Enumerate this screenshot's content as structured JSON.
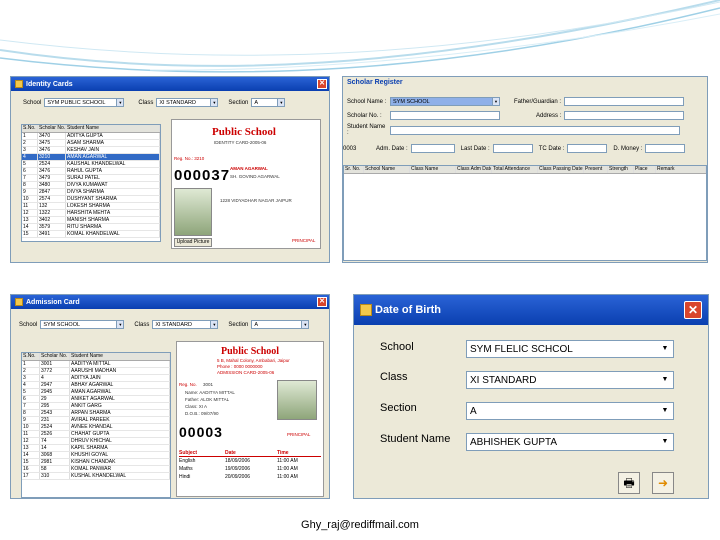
{
  "footer": {
    "email": "Ghy_raj@rediffmail.com"
  },
  "identity_window": {
    "title": "Identity Cards",
    "school_label": "School",
    "school_value": "SYM PUBLIC SCHOOL",
    "class_label": "Class",
    "class_value": "XI STANDARD",
    "section_label": "Section",
    "section_value": "A",
    "grid_headers": [
      "S.No.",
      "Scholar No.",
      "Student Name"
    ],
    "rows": [
      [
        "1",
        "3470",
        "ADITYA GUPTA"
      ],
      [
        "2",
        "3475",
        "ASAM SHARMA"
      ],
      [
        "3",
        "3476",
        "KESHAV JAIN"
      ],
      [
        "4",
        "3210",
        "AMAN AGARWAL"
      ],
      [
        "5",
        "2524",
        "KAUSHAL KHANDELWAL"
      ],
      [
        "6",
        "3476",
        "RAHUL GUPTA"
      ],
      [
        "7",
        "3479",
        "SURAJ PATEL"
      ],
      [
        "8",
        "3480",
        "DIVYA KUMAWAT"
      ],
      [
        "9",
        "2847",
        "DIVYA SHARMA"
      ],
      [
        "10",
        "2574",
        "DUSHYANT SHARMA"
      ],
      [
        "11",
        "132",
        "LOKESH SHARMA"
      ],
      [
        "12",
        "1322",
        "HARSHITA MEHTA"
      ],
      [
        "13",
        "3402",
        "MANISH SHARMA"
      ],
      [
        "14",
        "3579",
        "RITU SHARMA"
      ],
      [
        "15",
        "3491",
        "KOMAL KHANDELWAL"
      ]
    ],
    "card_school": "Public School",
    "card_subtitle": "IDENTITY CARD-2005-06",
    "card_number": "000037",
    "card_name": "AMAN AGARWAL",
    "card_reg": "Reg. No.: 3210",
    "card_father": "SH. GOVIND AGARWAL",
    "card_address": "1228 VIDYADHAR NAGAR JAIPUR",
    "card_principal": "PRINCIPAL",
    "upload_button": "Upload Picture"
  },
  "scholar_window": {
    "title": "Scholar Register",
    "school_label": "School Name :",
    "school_value": "SYM SCHOOL",
    "father_label": "Father/Guardian :",
    "scholar_no_label": "Scholar No. :",
    "address_label": "Address :",
    "student_name_label": "Student Name :",
    "code": "0003",
    "adm_date_label": "Adm. Date :",
    "last_date_label": "Last Date :",
    "tc_date_label": "TC Date :",
    "money_label": "D. Money :",
    "grid_headers": [
      "Sr. No.",
      "School Name",
      "Class Name",
      "Class Adm Date",
      "Total Attendance",
      "Class Passing Date",
      "Present",
      "Strength",
      "Place",
      "Remark"
    ]
  },
  "admission_window": {
    "title": "Admission Card",
    "school_label": "School",
    "school_value": "SYM SCHOOL",
    "class_label": "Class",
    "class_value": "XI STANDARD",
    "section_label": "Section",
    "section_value": "A",
    "grid_headers": [
      "S.No.",
      "Scholar No.",
      "Student Name"
    ],
    "rows": [
      [
        "1",
        "3001",
        "AADITYA MITTAL"
      ],
      [
        "2",
        "3772",
        "AARUSHI MADHAN"
      ],
      [
        "3",
        "4",
        "ADITYA JAIN"
      ],
      [
        "4",
        "2947",
        "ABHAY AGARWAL"
      ],
      [
        "5",
        "2945",
        "AMAN AGARWAL"
      ],
      [
        "6",
        "29",
        "ANIKET AGARWAL"
      ],
      [
        "7",
        "295",
        "ANKIT GARG"
      ],
      [
        "8",
        "2543",
        "ARPAN SHARMA"
      ],
      [
        "9",
        "231",
        "AVIRAL PAREEK"
      ],
      [
        "10",
        "2524",
        "AVNEE KHANDAL"
      ],
      [
        "11",
        "2526",
        "CHAHAT GUPTA"
      ],
      [
        "12",
        "74",
        "DHRUV KHICHAL"
      ],
      [
        "13",
        "14",
        "KAPIL SHARMA"
      ],
      [
        "14",
        "3068",
        "KHUSHI GOYAL"
      ],
      [
        "15",
        "2981",
        "KISHAN CHANDAK"
      ],
      [
        "16",
        "58",
        "KOMAL PANWAR"
      ],
      [
        "17",
        "310",
        "KUSHAL KHANDELWAL"
      ]
    ],
    "card_school": "Public School",
    "card_addr": "5 B, Mahal Colony, Ambabari, Jaipur",
    "card_phone": "Phone : 0000 0000000",
    "card_subtitle": "ADMISSION CARD-2005-06",
    "reg_label": "Reg. No.",
    "reg_value": "3001",
    "card_name": "Name: AADITYA MITTAL",
    "card_father": "Father: ALOK MITTAL",
    "card_class": "Class: XI A",
    "card_dob": "D.O.B.: 09/07/90",
    "card_number": "00003",
    "card_principal": "PRINCIPAL",
    "exam_headers": [
      "Subject",
      "Date",
      "Time"
    ],
    "exam_rows": [
      [
        "English",
        "18/09/2006",
        "11:00 AM"
      ],
      [
        "Maths",
        "19/09/2006",
        "11:00 AM"
      ],
      [
        "Hindi",
        "20/09/2006",
        "11:00 AM"
      ]
    ]
  },
  "dob_window": {
    "title": "Date of Birth",
    "fields": [
      {
        "label": "School",
        "value": "SYM FLELIC SCHCOL"
      },
      {
        "label": "Class",
        "value": "XI STANDARD"
      },
      {
        "label": "Section",
        "value": "A"
      },
      {
        "label": "Student Name",
        "value": "ABHISHEK GUPTA"
      }
    ]
  },
  "colors": {
    "titlebar": "#0a3fb0",
    "accent_red": "#cc0000",
    "selection": "#316ac5"
  }
}
